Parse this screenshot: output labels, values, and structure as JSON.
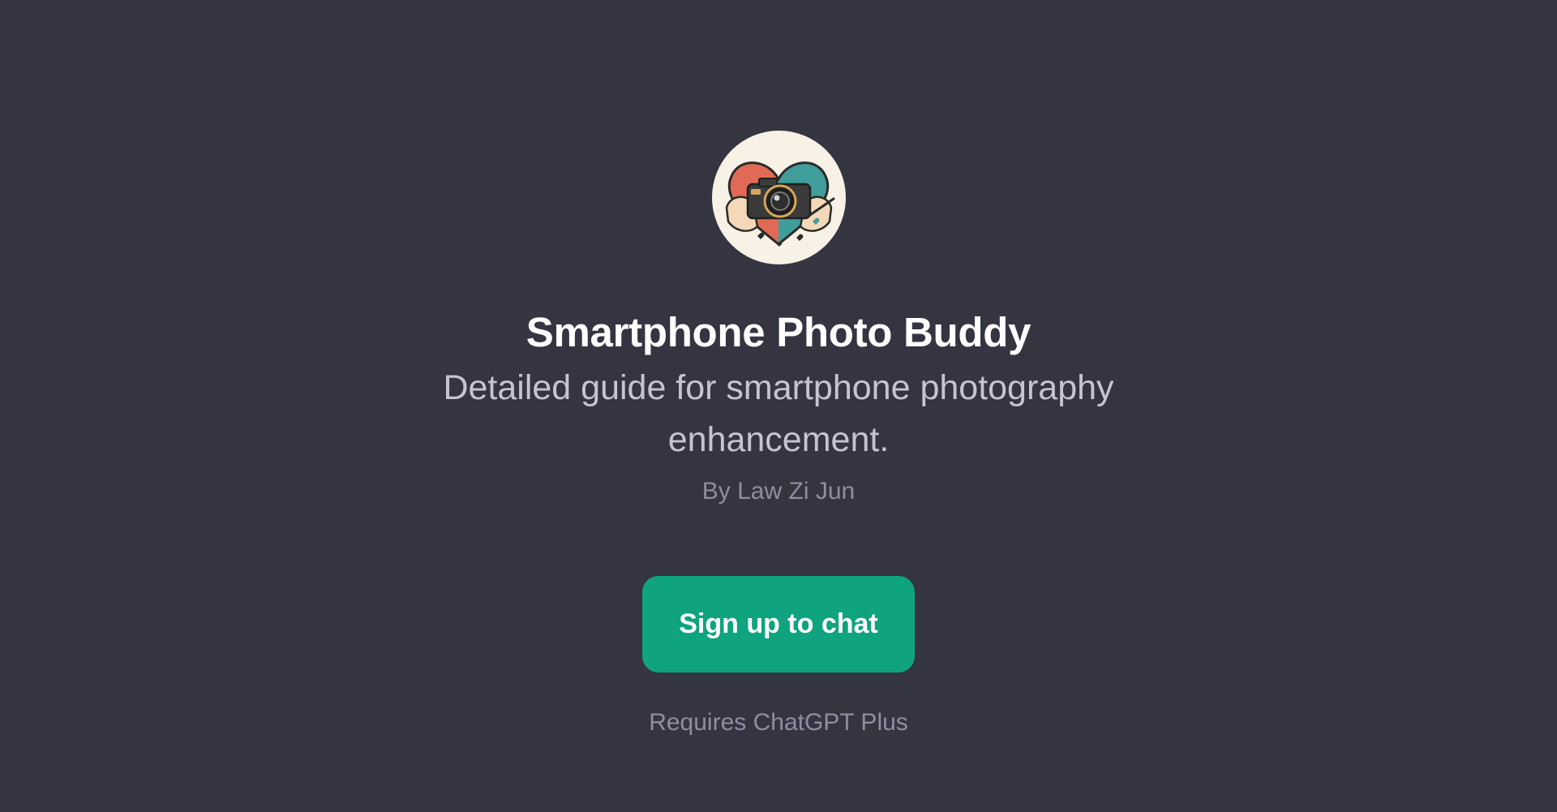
{
  "gpt": {
    "avatar_icon": "camera-heart-avatar-icon",
    "title": "Smartphone Photo Buddy",
    "description": "Detailed guide for smartphone photography enhancement.",
    "author": "By Law Zi Jun"
  },
  "actions": {
    "signup_label": "Sign up to chat",
    "requirement": "Requires ChatGPT Plus"
  },
  "colors": {
    "background": "#343541",
    "accent": "#10a37f",
    "title": "#ffffff",
    "description": "#c5c5d2",
    "muted": "#8e8ea0"
  }
}
